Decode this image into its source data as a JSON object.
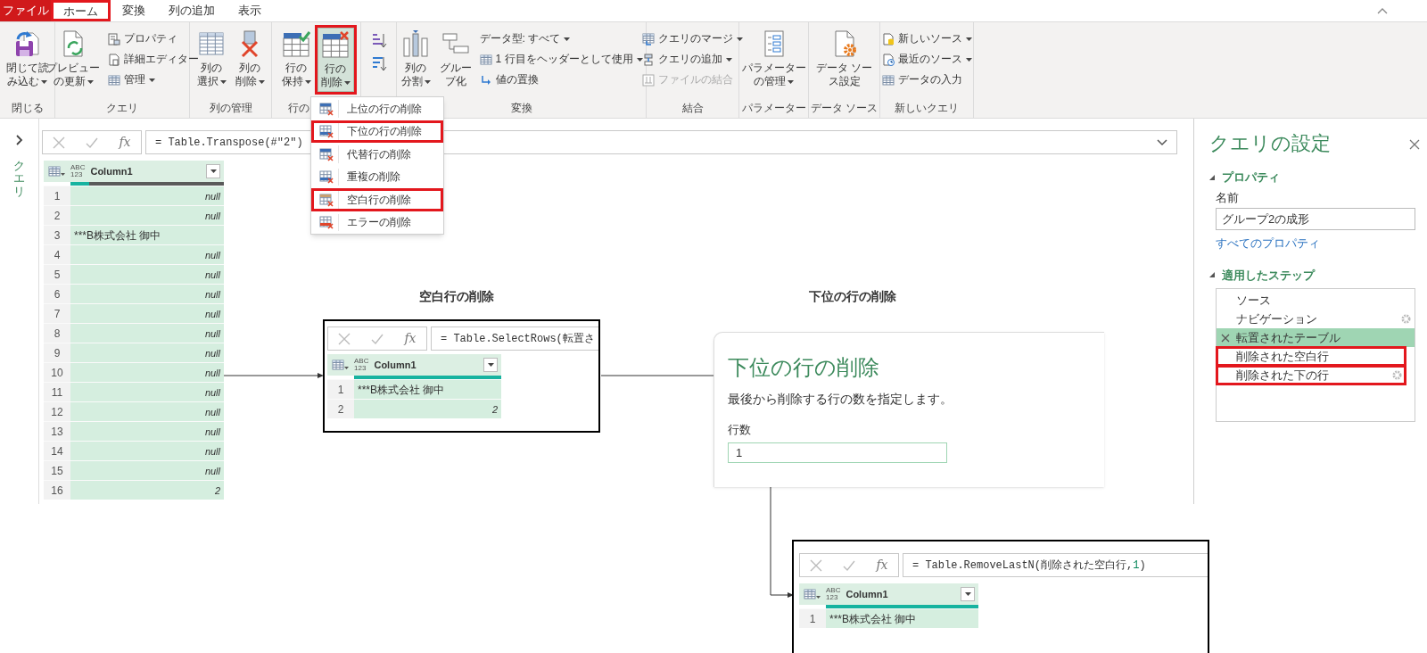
{
  "menu_tabs": [
    {
      "label": "ファイル",
      "kind": "file",
      "selected": false,
      "highlighted": false
    },
    {
      "label": "ホーム",
      "kind": "tab",
      "selected": true,
      "highlighted": true
    },
    {
      "label": "変換",
      "kind": "tab",
      "selected": false,
      "highlighted": false
    },
    {
      "label": "列の追加",
      "kind": "tab",
      "selected": false,
      "highlighted": false
    },
    {
      "label": "表示",
      "kind": "tab",
      "selected": false,
      "highlighted": false
    }
  ],
  "ribbon_groups": [
    {
      "label": "閉じる",
      "items": [
        {
          "kind": "large",
          "lines": [
            "閉じて読",
            "み込む"
          ],
          "dropdown": true,
          "disabled": false,
          "pressed": false,
          "highlighted": false
        }
      ]
    },
    {
      "label": "クエリ",
      "items": [
        {
          "kind": "large",
          "lines": [
            "プレビュー",
            "の更新"
          ],
          "dropdown": true,
          "disabled": false,
          "pressed": false,
          "highlighted": false
        },
        {
          "kind": "small",
          "lines": [
            "プロパティ"
          ],
          "dropdown": false,
          "disabled": false,
          "pressed": false,
          "highlighted": false
        },
        {
          "kind": "small",
          "lines": [
            "詳細エディター"
          ],
          "dropdown": false,
          "disabled": false,
          "pressed": false,
          "highlighted": false
        },
        {
          "kind": "small",
          "lines": [
            "管理"
          ],
          "dropdown": true,
          "disabled": false,
          "pressed": false,
          "highlighted": false
        }
      ]
    },
    {
      "label": "列の管理",
      "items": [
        {
          "kind": "large",
          "lines": [
            "列の",
            "選択"
          ],
          "dropdown": true,
          "disabled": false,
          "pressed": false,
          "highlighted": false
        },
        {
          "kind": "large",
          "lines": [
            "列の",
            "削除"
          ],
          "dropdown": true,
          "disabled": false,
          "pressed": false,
          "highlighted": false
        }
      ]
    },
    {
      "label": "行の",
      "items": [
        {
          "kind": "large",
          "lines": [
            "行の",
            "保持"
          ],
          "dropdown": true,
          "disabled": false,
          "pressed": false,
          "highlighted": false
        },
        {
          "kind": "large",
          "lines": [
            "行の",
            "削除"
          ],
          "dropdown": true,
          "disabled": false,
          "pressed": true,
          "highlighted": true
        }
      ]
    },
    {
      "items": [
        {
          "kind": "icon",
          "dropdown": false,
          "disabled": false,
          "pressed": false,
          "highlighted": false
        },
        {
          "kind": "icon",
          "dropdown": false,
          "disabled": false,
          "pressed": false,
          "highlighted": false
        }
      ]
    },
    {
      "label": "変換",
      "items": [
        {
          "kind": "large",
          "lines": [
            "列の",
            "分割"
          ],
          "dropdown": true,
          "disabled": false,
          "pressed": false,
          "highlighted": false
        },
        {
          "kind": "large",
          "lines": [
            "グルー",
            "プ化"
          ],
          "dropdown": false,
          "disabled": false,
          "pressed": false,
          "highlighted": false
        },
        {
          "kind": "small",
          "lines": [
            "データ型: すべて"
          ],
          "dropdown": true,
          "disabled": false,
          "pressed": false,
          "highlighted": false
        },
        {
          "kind": "small",
          "lines": [
            "1 行目をヘッダーとして使用"
          ],
          "dropdown": true,
          "disabled": false,
          "pressed": false,
          "highlighted": false
        },
        {
          "kind": "small",
          "lines": [
            "値の置換"
          ],
          "dropdown": false,
          "disabled": false,
          "pressed": false,
          "highlighted": false
        }
      ]
    },
    {
      "label": "結合",
      "items": [
        {
          "kind": "small",
          "lines": [
            "クエリのマージ"
          ],
          "dropdown": true,
          "disabled": false,
          "pressed": false,
          "highlighted": false
        },
        {
          "kind": "small",
          "lines": [
            "クエリの追加"
          ],
          "dropdown": true,
          "disabled": false,
          "pressed": false,
          "highlighted": false
        },
        {
          "kind": "small",
          "lines": [
            "ファイルの結合"
          ],
          "dropdown": false,
          "disabled": true,
          "pressed": false,
          "highlighted": false
        }
      ]
    },
    {
      "label": "パラメーター",
      "items": [
        {
          "kind": "large",
          "lines": [
            "パラメーター",
            "の管理"
          ],
          "dropdown": true,
          "disabled": false,
          "pressed": false,
          "highlighted": false
        }
      ]
    },
    {
      "label": "データ ソース",
      "items": [
        {
          "kind": "large",
          "lines": [
            "データ ソー",
            "ス設定"
          ],
          "dropdown": false,
          "disabled": false,
          "pressed": false,
          "highlighted": false
        }
      ]
    },
    {
      "label": "新しいクエリ",
      "items": [
        {
          "kind": "small",
          "lines": [
            "新しいソース"
          ],
          "dropdown": true,
          "disabled": false,
          "pressed": false,
          "highlighted": false
        },
        {
          "kind": "small",
          "lines": [
            "最近のソース"
          ],
          "dropdown": true,
          "disabled": false,
          "pressed": false,
          "highlighted": false
        },
        {
          "kind": "small",
          "lines": [
            "データの入力"
          ],
          "dropdown": false,
          "disabled": false,
          "pressed": false,
          "highlighted": false
        }
      ]
    }
  ],
  "remove_rows_menu": [
    {
      "label": "上位の行の削除",
      "highlighted": false
    },
    {
      "label": "下位の行の削除",
      "highlighted": true
    },
    {
      "label": "代替行の削除",
      "highlighted": false
    },
    {
      "label": "重複の削除",
      "highlighted": false
    },
    {
      "label": "空白行の削除",
      "highlighted": true
    },
    {
      "label": "エラーの削除",
      "highlighted": false
    }
  ],
  "queries_pane": {
    "label": "クエリ"
  },
  "formula_bar": {
    "fx": "fx",
    "formula_parts": [
      {
        "text": "= Table.Transpose(#\"2\")",
        "kind": "code"
      }
    ]
  },
  "table": {
    "type_label": [
      "ABC",
      "123"
    ],
    "column": "Column1",
    "quality_bar": {
      "level": 0.12
    },
    "rows": [
      {
        "number": "1",
        "value": "null",
        "kind": "null"
      },
      {
        "number": "2",
        "value": "null",
        "kind": "null"
      },
      {
        "number": "3",
        "value": "***B株式会社 御中",
        "kind": "text"
      },
      {
        "number": "4",
        "value": "null",
        "kind": "null"
      },
      {
        "number": "5",
        "value": "null",
        "kind": "null"
      },
      {
        "number": "6",
        "value": "null",
        "kind": "null"
      },
      {
        "number": "7",
        "value": "null",
        "kind": "null"
      },
      {
        "number": "8",
        "value": "null",
        "kind": "null"
      },
      {
        "number": "9",
        "value": "null",
        "kind": "null"
      },
      {
        "number": "10",
        "value": "null",
        "kind": "null"
      },
      {
        "number": "11",
        "value": "null",
        "kind": "null"
      },
      {
        "number": "12",
        "value": "null",
        "kind": "null"
      },
      {
        "number": "13",
        "value": "null",
        "kind": "null"
      },
      {
        "number": "14",
        "value": "null",
        "kind": "null"
      },
      {
        "number": "15",
        "value": "null",
        "kind": "null"
      },
      {
        "number": "16",
        "value": "2",
        "kind": "number"
      }
    ]
  },
  "callouts": [
    {
      "title": "空白行の削除"
    },
    {
      "title": "下位の行の削除"
    }
  ],
  "blank_rows_result": {
    "formula_bar": {
      "fx": "fx",
      "formula_parts": [
        {
          "text": "= Table.SelectRows(転置さ",
          "kind": "code"
        }
      ]
    },
    "table": {
      "type_label": [
        "ABC",
        "123"
      ],
      "column": "Column1",
      "quality_bar": {
        "level": 1
      },
      "rows": [
        {
          "number": "1",
          "value": "***B株式会社 御中",
          "kind": "text"
        },
        {
          "number": "2",
          "value": "2",
          "kind": "number"
        }
      ]
    }
  },
  "remove_bottom_rows_dialog": {
    "title": "下位の行の削除",
    "description": "最後から削除する行の数を指定します。",
    "field_label": "行数",
    "field_value": "1"
  },
  "bottom_rows_result": {
    "formula_bar": {
      "fx": "fx",
      "formula_parts": [
        {
          "text": "= Table.RemoveLastN(削除された空白行,",
          "kind": "code"
        },
        {
          "text": "1",
          "kind": "number"
        },
        {
          "text": ")",
          "kind": "code"
        }
      ]
    },
    "table": {
      "type_label": [
        "ABC",
        "123"
      ],
      "column": "Column1",
      "quality_bar": {
        "level": 1
      },
      "rows": [
        {
          "number": "1",
          "value": "***B株式会社 御中",
          "kind": "text"
        }
      ]
    }
  },
  "query_settings": {
    "title": "クエリの設定",
    "properties_heading": "プロパティ",
    "name_label": "名前",
    "name_value": "グループ2の成形",
    "all_properties_link": "すべてのプロパティ",
    "steps_heading": "適用したステップ",
    "steps": [
      {
        "label": "ソース",
        "selected": false,
        "highlighted": false,
        "settings": false
      },
      {
        "label": "ナビゲーション",
        "selected": false,
        "highlighted": false,
        "settings": true
      },
      {
        "label": "転置されたテーブル",
        "selected": true,
        "highlighted": false,
        "settings": false
      },
      {
        "label": "削除された空白行",
        "selected": false,
        "highlighted": true,
        "settings": false
      },
      {
        "label": "削除された下の行",
        "selected": false,
        "highlighted": true,
        "settings": true
      }
    ]
  }
}
